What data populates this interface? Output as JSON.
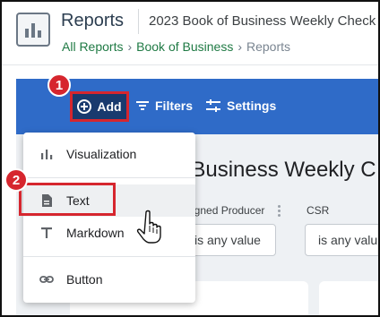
{
  "header": {
    "app_icon": "bar-chart-icon",
    "title": "Reports",
    "subtitle": "2023 Book of Business Weekly Check",
    "breadcrumbs": [
      "All Reports",
      "Book of Business",
      "Reports"
    ]
  },
  "toolbar": {
    "add_label": "Add",
    "filters_label": "Filters",
    "settings_label": "Settings"
  },
  "callouts": [
    "1",
    "2"
  ],
  "dropdown": {
    "items": [
      {
        "label": "Visualization",
        "icon": "bar-chart-icon"
      },
      {
        "label": "Text",
        "icon": "document-icon"
      },
      {
        "label": "Markdown",
        "icon": "text-t-icon"
      },
      {
        "label": "Button",
        "icon": "link-icon"
      }
    ]
  },
  "report": {
    "title_fragment": "f Business Weekly C",
    "filters": [
      {
        "label": "signed Producer",
        "value": "is any value"
      },
      {
        "label": "CSR",
        "value": "is any valu"
      }
    ]
  },
  "colors": {
    "toolbar_blue": "#2f6bc8",
    "add_button": "#193a6e",
    "callout_red": "#d6262e",
    "breadcrumb_green": "#1f7a44"
  }
}
